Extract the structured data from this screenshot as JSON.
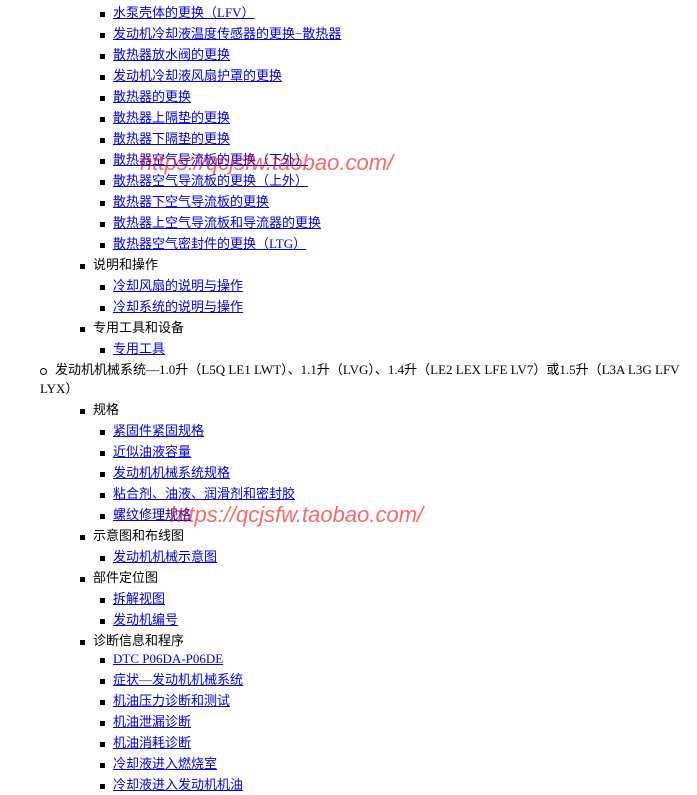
{
  "watermark": "https://qcjsfw.taobao.com/",
  "top_links": [
    "水泵壳体的更换（LFV）",
    "发动机冷却液温度传感器的更换−散热器",
    "散热器放水阀的更换",
    "发动机冷却液风扇护罩的更换",
    "散热器的更换",
    "散热器上隔垫的更换",
    "散热器下隔垫的更换",
    "散热器空气导流板的更换（下外）",
    "散热器空气导流板的更换（上外）",
    "散热器下空气导流板的更换",
    "散热器上空气导流板和导流器的更换",
    "散热器空气密封件的更换（LTG）"
  ],
  "section_shuoming": {
    "label": "说明和操作",
    "items": [
      "冷却风扇的说明与操作",
      "冷却系统的说明与操作"
    ]
  },
  "section_tool": {
    "label": "专用工具和设备",
    "items": [
      "专用工具"
    ]
  },
  "engine_header": "发动机机械系统—1.0升（L5Q LE1 LWT）、1.1升（LVG）、1.4升（LE2 LEX LFE LV7）或1.5升（L3A L3G LFV LYX）",
  "section_guige": {
    "label": "规格",
    "items": [
      "紧固件紧固规格",
      "近似油液容量",
      "发动机机械系统规格",
      "粘合剂、油液、润滑剂和密封胶",
      "螺纹修理规格"
    ]
  },
  "section_shiyitu": {
    "label": "示意图和布线图",
    "items": [
      "发动机机械示意图"
    ]
  },
  "section_bujian": {
    "label": "部件定位图",
    "items": [
      "拆解视图",
      "发动机编号"
    ]
  },
  "section_zhenduan": {
    "label": "诊断信息和程序",
    "items": [
      "DTC P06DA-P06DE",
      "症状—发动机机械系统",
      "机油压力诊断和测试",
      "机油泄漏诊断",
      "机油消耗诊断",
      "冷却液进入燃烧室",
      "冷却液进入发动机机油"
    ]
  }
}
